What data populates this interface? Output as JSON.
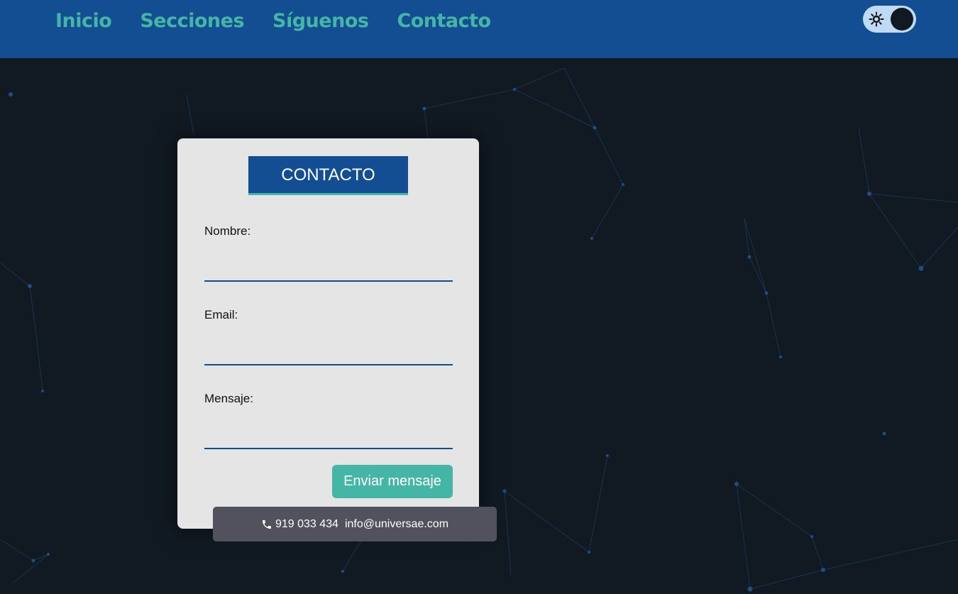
{
  "nav": {
    "items": [
      {
        "label": "Inicio"
      },
      {
        "label": "Secciones"
      },
      {
        "label": "Síguenos"
      },
      {
        "label": "Contacto"
      }
    ]
  },
  "theme_toggle": {
    "icon": "sun-icon",
    "state": "dark"
  },
  "form": {
    "title": "CONTACTO",
    "fields": [
      {
        "label": "Nombre:",
        "value": ""
      },
      {
        "label": "Email:",
        "value": ""
      },
      {
        "label": "Mensaje:",
        "value": ""
      }
    ],
    "submit_label": "Enviar mensaje"
  },
  "footer": {
    "phone": "919 033 434",
    "email": "info@universae.com",
    "phone_icon": "phone-icon"
  },
  "colors": {
    "header_bg": "#134e92",
    "accent": "#45b5a6",
    "page_bg": "#111922",
    "card_bg": "#e5e5e5",
    "footer_bg": "#52525e"
  }
}
